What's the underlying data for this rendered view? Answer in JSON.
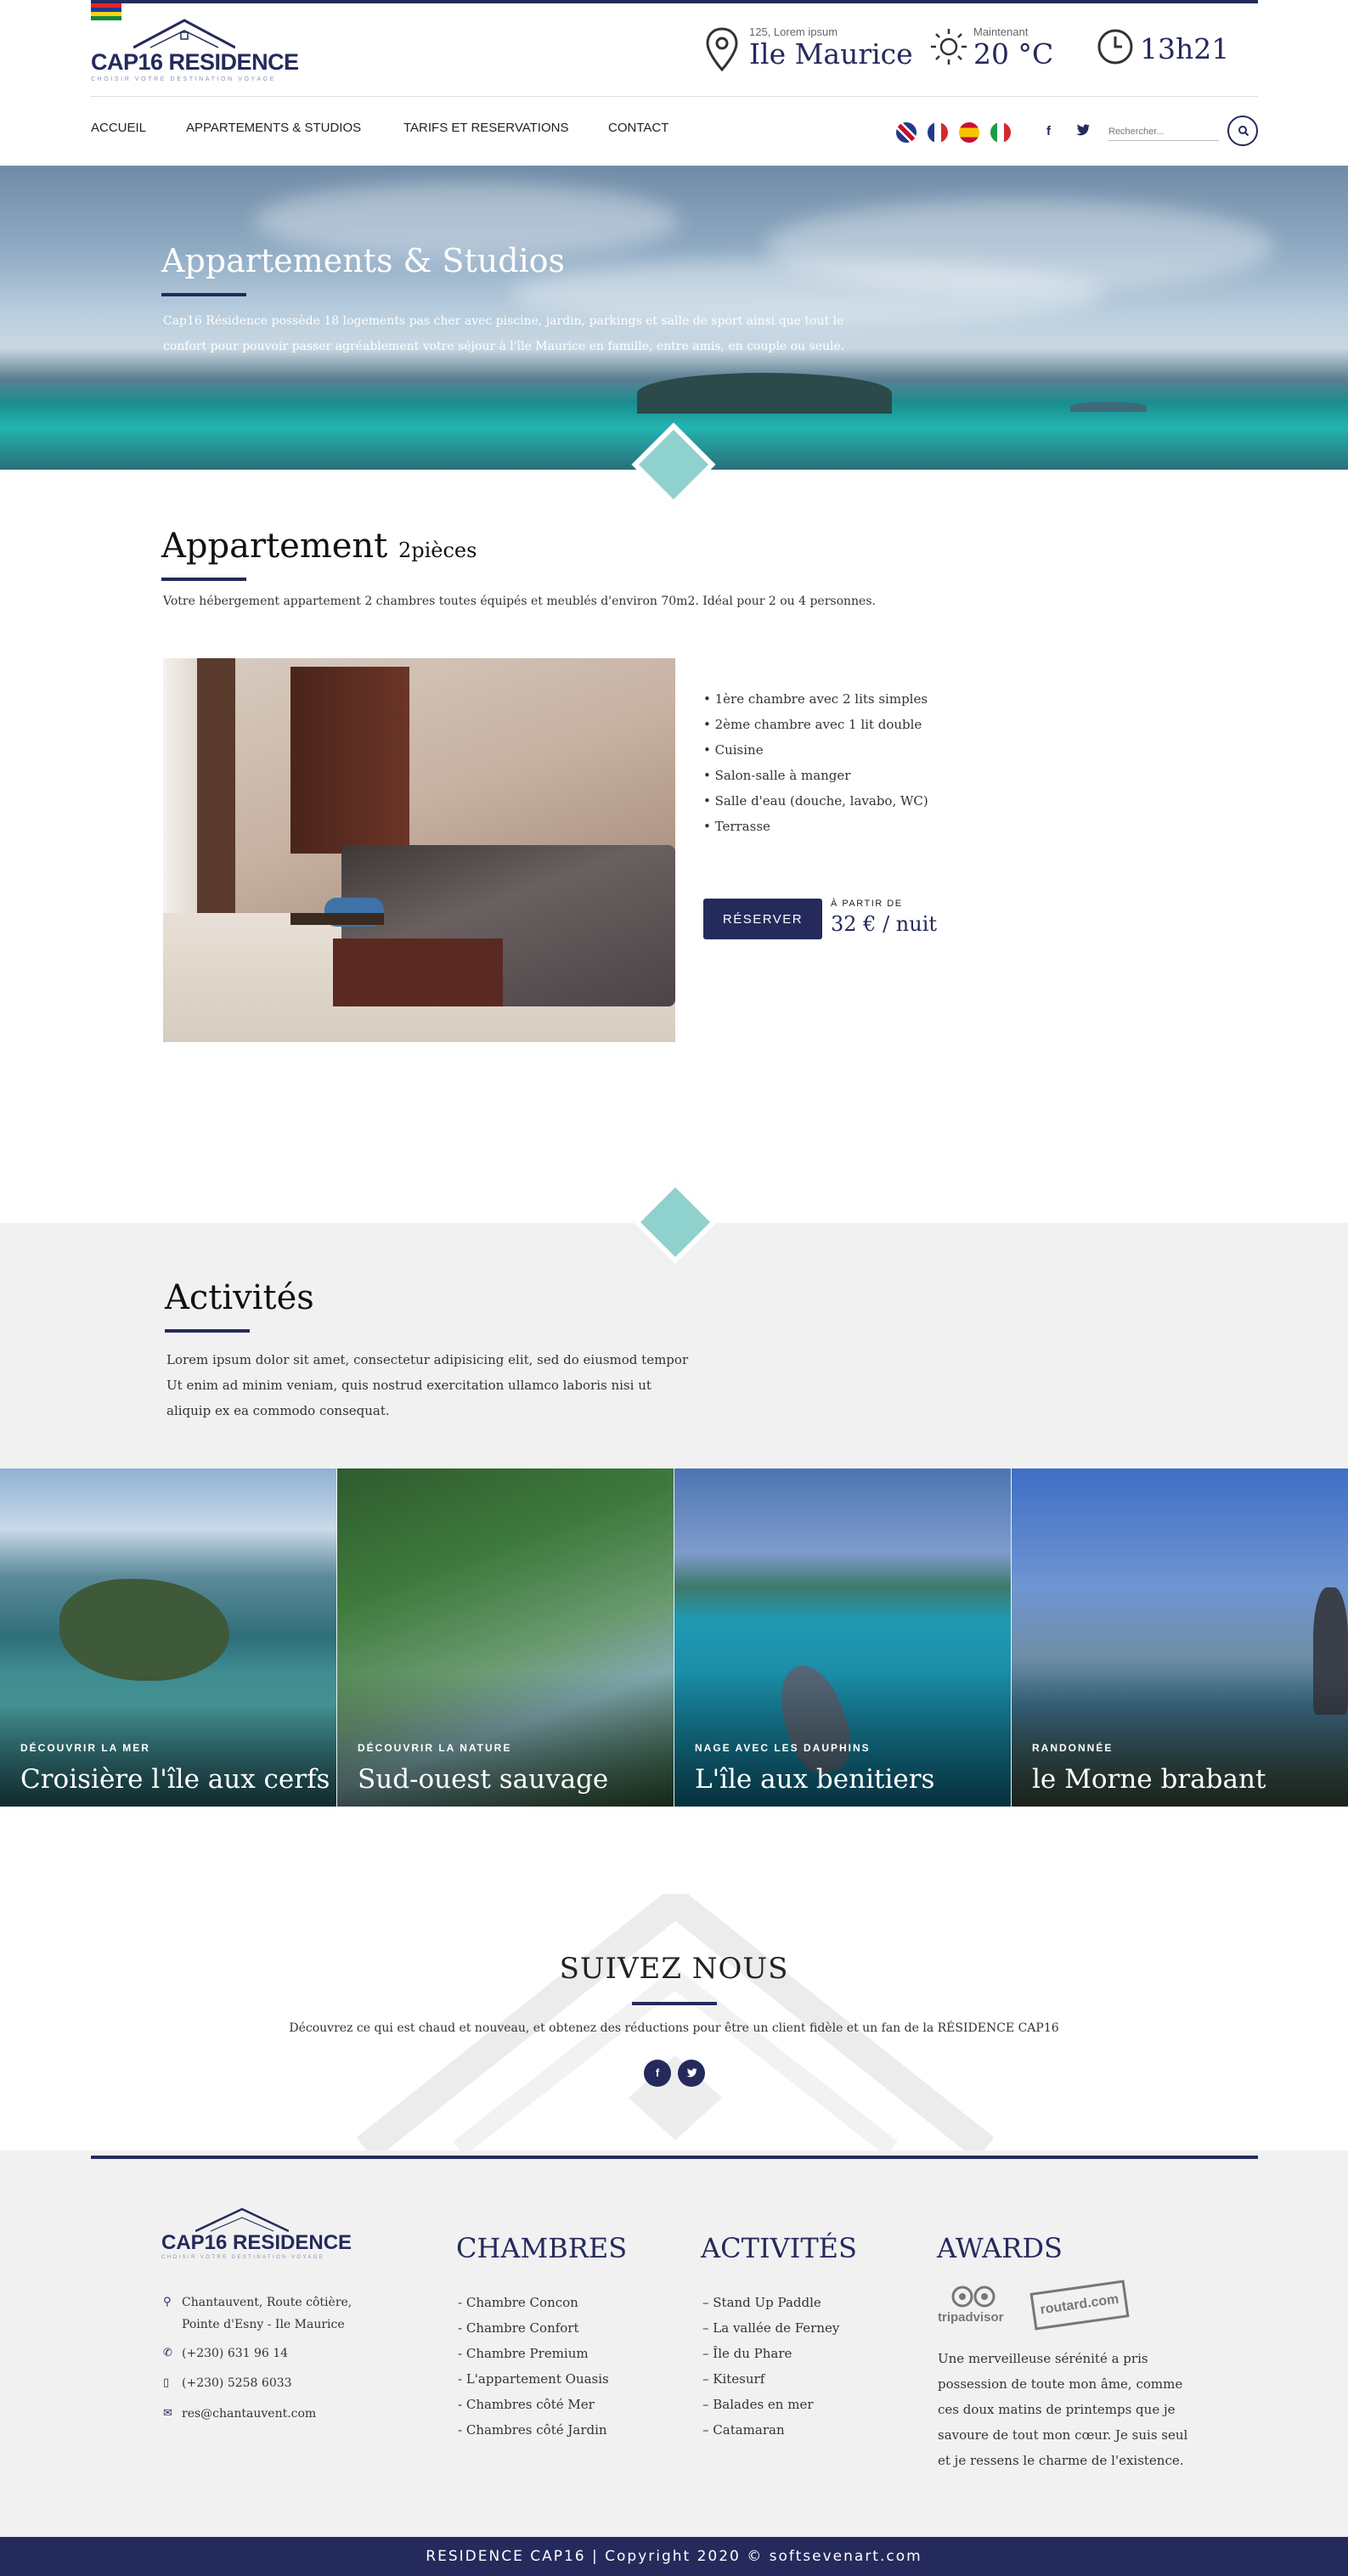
{
  "header": {
    "logo_text": "CAP16 RESIDENCE",
    "logo_tagline": "CHOISIR VOTRE DESTINATION VOYAGE",
    "location_small": "125, Lorem ipsum",
    "location_big": "Ile Maurice",
    "weather_small": "Maintenant",
    "weather_big": "20 °C",
    "time_big": "13h21"
  },
  "nav": {
    "items": [
      "ACCUEIL",
      "APPARTEMENTS & STUDIOS",
      "TARIFS ET RESERVATIONS",
      "CONTACT"
    ],
    "search_placeholder": "Rechercher..."
  },
  "hero": {
    "title": "Appartements & Studios",
    "text": "Cap16 Résidence possède 18 logements pas cher avec piscine, jardin, parkings et salle de sport ainsi que tout le confort pour pouvoir passer agréablement votre séjour à l'île Maurice en famille, entre amis, en couple ou seule."
  },
  "apartment": {
    "title": "Appartement",
    "title_small": "2pièces",
    "description": "Votre hébergement appartement 2 chambres toutes équipés et meublés d'environ 70m2. Idéal pour 2 ou 4 personnes.",
    "features": [
      "• 1ère chambre avec 2 lits simples",
      "• 2ème chambre avec 1 lit double",
      "• Cuisine",
      "• Salon-salle à manger",
      "• Salle d'eau (douche, lavabo, WC)",
      "• Terrasse"
    ],
    "reserve_label": "RÉSERVER",
    "from_label": "À PARTIR DE",
    "price": "32 € / nuit"
  },
  "activities": {
    "title": "Activités",
    "text": "Lorem ipsum dolor sit amet, consectetur adipisicing elit, sed do eiusmod tempor Ut enim ad minim veniam, quis nostrud exercitation ullamco laboris nisi ut aliquip ex ea commodo consequat.",
    "tiles": [
      {
        "category": "DÉCOUVRIR LA MER",
        "name": "Croisière l'île aux cerfs"
      },
      {
        "category": "DÉCOUVRIR LA NATURE",
        "name": "Sud-ouest sauvage"
      },
      {
        "category": "NAGE AVEC LES DAUPHINS",
        "name": "L'île aux benitiers"
      },
      {
        "category": "RANDONNÉE",
        "name": "le Morne brabant"
      }
    ]
  },
  "follow": {
    "title": "SUIVEZ NOUS",
    "text": "Découvrez ce qui est chaud et nouveau, et obtenez des réductions pour être un client fidèle et un fan de la RÉSIDENCE CAP16"
  },
  "footer": {
    "contact": {
      "address_line1": "Chantauvent, Route côtière,",
      "address_line2": "Pointe d'Esny - Ile Maurice",
      "phone": "(+230) 631 96 14",
      "mobile": "(+230) 5258 6033",
      "email": "res@chantauvent.com"
    },
    "rooms_title": "CHAMBRES",
    "rooms": [
      "- Chambre Concon",
      "- Chambre Confort",
      "- Chambre Premium",
      "- L'appartement Ouasis",
      "- Chambres côté Mer",
      "- Chambres côté Jardin"
    ],
    "activities_title": "ACTIVITÉS",
    "activities": [
      "– Stand Up Paddle",
      "– La vallée de Ferney",
      "– Île du Phare",
      "– Kitesurf",
      "– Balades en mer",
      "– Catamaran"
    ],
    "awards_title": "AWARDS",
    "award_tripadvisor": "tripadvisor",
    "award_routard": "routard.com",
    "awards_text": "Une merveilleuse sérénité a pris possession de toute mon âme, comme ces doux matins de printemps que je savoure de tout mon cœur. Je suis seul et je ressens le charme de l'existence.",
    "copyright": "RESIDENCE CAP16 | Copyright 2020 © softsevenart.com"
  },
  "colors": {
    "brand_navy": "#252a5c",
    "accent_teal": "#8fd1cc",
    "section_gray": "#f1f1f1"
  }
}
